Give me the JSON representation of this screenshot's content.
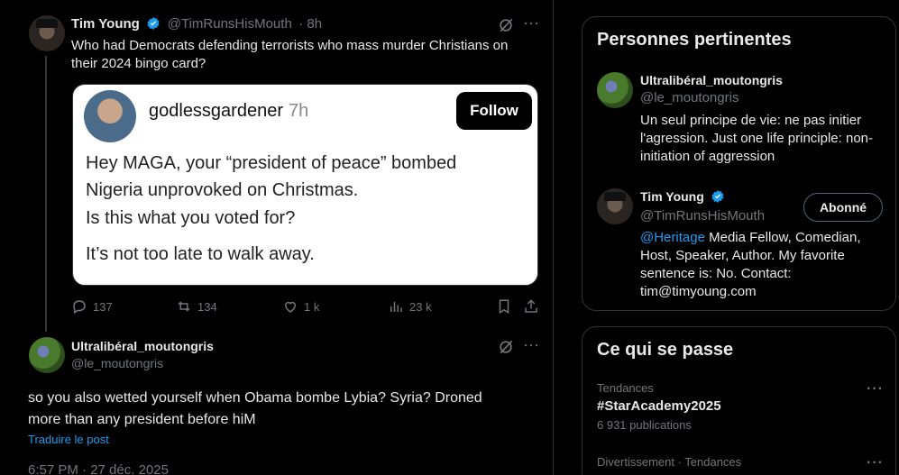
{
  "tweet1": {
    "author_name": "Tim Young",
    "author_handle": "@TimRunsHisMouth",
    "time": "· 8h",
    "text_line1": "Who had Democrats defending terrorists who mass murder Christians on",
    "text_line2": "their 2024 bingo card?",
    "embed": {
      "username": "godlessgardener",
      "time": "7h",
      "follow_label": "Follow",
      "line1": "Hey MAGA, your “president of peace” bombed",
      "line2": "Nigeria unprovoked on Christmas.",
      "line3": "Is this what you voted for?",
      "line4": "It’s not too late to walk away."
    },
    "stats": {
      "replies": "137",
      "reposts": "134",
      "likes": "1 k",
      "views": "23 k"
    }
  },
  "tweet2": {
    "author_name": "Ultralibéral_moutongris",
    "author_handle": "@le_moutongris",
    "text_line1": "so you also wetted yourself when Obama bombe Lybia? Syria? Droned",
    "text_line2": "more than any president before hiM",
    "translate_label": "Traduire le post",
    "timestamp": "6:57 PM · 27 déc. 2025"
  },
  "relevant_people": {
    "title": "Personnes pertinentes",
    "people": [
      {
        "name": "Ultralibéral_moutongris",
        "handle": "@le_moutongris",
        "bio_line1": "Un seul principe de vie: ne pas initier",
        "bio_line2": "l'agression. Just one life principle: non-",
        "bio_line3": "initiation of aggression"
      },
      {
        "name": "Tim Young",
        "handle": "@TimRunsHisMouth",
        "follow_label": "Abonné",
        "bio_mention": "@Heritage",
        "bio_line1_rest": " Media Fellow, Comedian,",
        "bio_line2": "Host, Speaker, Author. My favorite",
        "bio_line3": "sentence is: No. Contact:",
        "bio_line4": "tim@timyoung.com"
      }
    ]
  },
  "trending": {
    "title": "Ce qui se passe",
    "items": [
      {
        "context": "Tendances",
        "topic": "#StarAcademy2025",
        "count": "6 931 publications"
      },
      {
        "context": "Divertissement · Tendances"
      }
    ]
  },
  "colors": {
    "background": "#000000",
    "accent": "#1d9bf0",
    "text": "#e7e9ea",
    "muted": "#71767b",
    "border": "#2f3336"
  }
}
